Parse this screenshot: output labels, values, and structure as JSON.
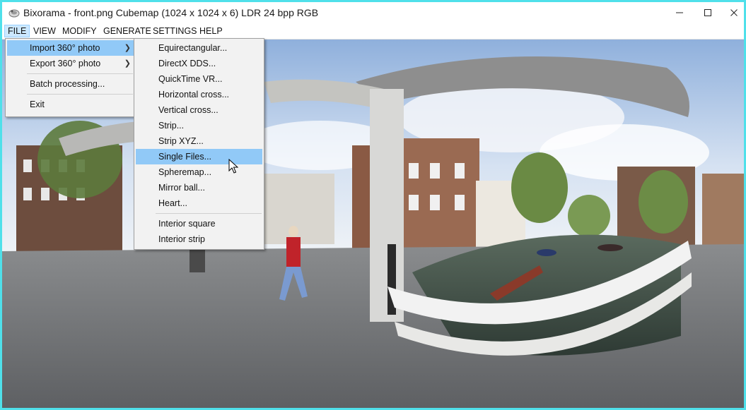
{
  "window": {
    "title": "Bixorama - front.png Cubemap (1024 x 1024 x 6) LDR 24 bpp RGB",
    "controls": [
      "minimize-icon",
      "maximize-icon",
      "close-icon"
    ]
  },
  "menubar": {
    "items": [
      "FILE",
      "VIEW",
      "MODIFY",
      "GENERATE",
      "SETTINGS",
      "HELP"
    ],
    "active": "FILE"
  },
  "file_menu": {
    "items": [
      {
        "label": "Import 360° photo",
        "submenu": true,
        "highlighted": true
      },
      {
        "label": "Export 360° photo",
        "submenu": true,
        "highlighted": false
      },
      {
        "label": "Batch processing...",
        "submenu": false,
        "highlighted": false
      },
      {
        "label": "Exit",
        "submenu": false,
        "highlighted": false
      }
    ]
  },
  "import_submenu": {
    "items": [
      {
        "label": "Equirectangular...",
        "highlighted": false
      },
      {
        "label": "DirectX DDS...",
        "highlighted": false
      },
      {
        "label": "QuickTime VR...",
        "highlighted": false
      },
      {
        "label": "Horizontal cross...",
        "highlighted": false
      },
      {
        "label": "Vertical cross...",
        "highlighted": false
      },
      {
        "label": "Strip...",
        "highlighted": false
      },
      {
        "label": "Strip XYZ...",
        "highlighted": false
      },
      {
        "label": "Single Files...",
        "highlighted": true
      },
      {
        "label": "Spheremap...",
        "highlighted": false
      },
      {
        "label": "Mirror ball...",
        "highlighted": false
      },
      {
        "label": "Heart...",
        "highlighted": false
      },
      {
        "label": "Interior square",
        "highlighted": false
      },
      {
        "label": "Interior strip",
        "highlighted": false
      }
    ]
  },
  "colors": {
    "window_border": "#4fe0ea",
    "menu_highlight": "#91c9f7",
    "menubar_active": "#cce8ff",
    "menu_background": "#f2f2f2"
  }
}
